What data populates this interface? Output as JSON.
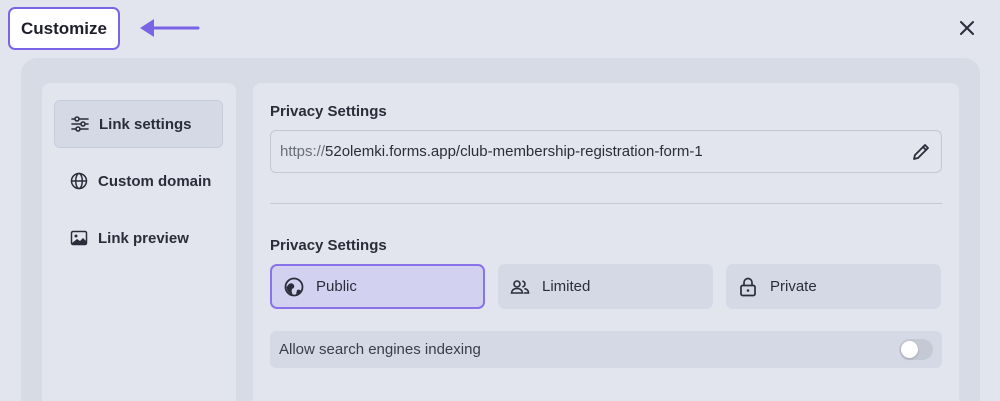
{
  "header": {
    "customize_label": "Customize",
    "arrow_icon": "arrow-left-icon",
    "close_icon": "close-icon"
  },
  "sidebar": {
    "items": [
      {
        "label": "Link settings",
        "icon": "sliders-icon",
        "active": true
      },
      {
        "label": "Custom domain",
        "icon": "globe-icon",
        "active": false
      },
      {
        "label": "Link preview",
        "icon": "image-icon",
        "active": false
      }
    ]
  },
  "main": {
    "link_section_title": "Privacy Settings",
    "url_prefix": "https://",
    "url_path": "52olemki.forms.app/club-membership-registration-form-1",
    "edit_icon": "pencil-icon",
    "privacy_section_title": "Privacy Settings",
    "privacy_options": [
      {
        "label": "Public",
        "icon": "globe-icon",
        "selected": true
      },
      {
        "label": "Limited",
        "icon": "users-icon",
        "selected": false
      },
      {
        "label": "Private",
        "icon": "lock-icon",
        "selected": false
      }
    ],
    "indexing_label": "Allow search engines indexing",
    "indexing_enabled": false
  },
  "colors": {
    "accent": "#7a64e6",
    "background": "#e2e5ee",
    "panel": "#d7dbe6"
  }
}
